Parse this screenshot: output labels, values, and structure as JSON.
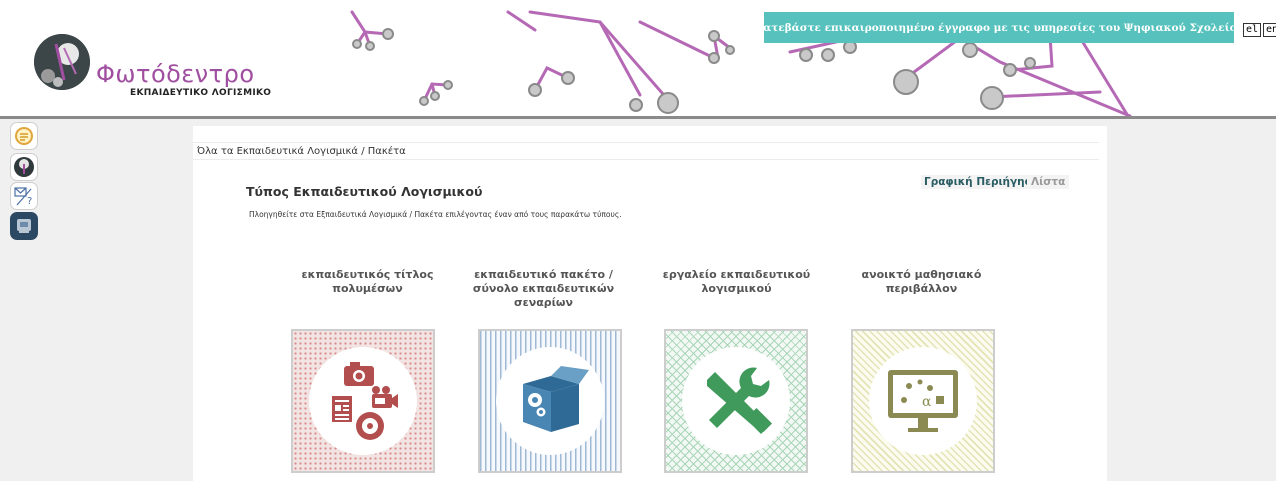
{
  "header": {
    "logo_title": "Φωτόδεντρο",
    "logo_subtitle": "ΕΚΠΑΙΔΕΥΤΙΚΟ ΛΟΓΙΣΜΙΚΟ",
    "banner_text": "Κατεβάστε επικαιροποιημένο έγγραφο με τις υπηρεσίες του Ψηφιακού Σχολείου",
    "languages": [
      "el",
      "en"
    ]
  },
  "side_tools": [
    "help-icon",
    "tree-icon",
    "contact-icon",
    "software-icon"
  ],
  "main": {
    "breadcrumb": "Όλα τα Εκπαιδευτικά Λογισμικά / Πακέτα",
    "view_graphic": "Γραφική Περιήγηση",
    "view_list": "Λίστα",
    "section_title": "Τύπος Εκπαιδευτικού Λογισμικού",
    "section_desc": "Πλοηγηθείτε στα Εξπαιδευτικά Λογισμικά / Πακέτα επιλέγοντας έναν από τους παρακάτω τύπους.",
    "types": [
      {
        "label": "εκπαιδευτικός τίτλος πολυμέσων",
        "icon": "multimedia-icon"
      },
      {
        "label": "εκπαιδευτικό πακέτο / σύνολο εκπαιδευτικών σεναρίων",
        "icon": "package-box-icon"
      },
      {
        "label": "εργαλείο εκπαιδευτικού λογισμικού",
        "icon": "tools-icon"
      },
      {
        "label": "ανοικτό μαθησιακό περιβάλλον",
        "icon": "learning-environment-icon"
      }
    ]
  },
  "colors": {
    "brand_purple": "#a04fa0",
    "banner_teal": "#57c2bd",
    "link_teal": "#2a5d63"
  }
}
